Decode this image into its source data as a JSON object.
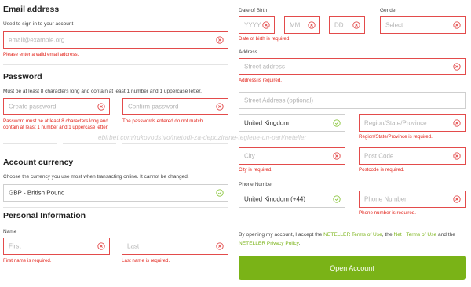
{
  "email": {
    "heading": "Email address",
    "helper": "Used to sign in to your account",
    "placeholder": "email@example.org",
    "error": "Please enter a valid email address."
  },
  "password": {
    "heading": "Password",
    "helper": "Must be at least 8 characters long and contain at least 1 number and 1 uppercase letter.",
    "create_placeholder": "Create password",
    "confirm_placeholder": "Confirm password",
    "create_error": "Password must be at least 8 characters long and contain at least 1 number and 1 uppercase letter.",
    "confirm_error": "The passwords entered do not match."
  },
  "currency": {
    "heading": "Account currency",
    "helper": "Choose the currency you use most when transacting online. It cannot be changed.",
    "value": "GBP - British Pound"
  },
  "personal": {
    "heading": "Personal Information",
    "name_label": "Name",
    "first_placeholder": "First",
    "last_placeholder": "Last",
    "first_error": "First name is required.",
    "last_error": "Last name is required."
  },
  "dob": {
    "label": "Date of Birth",
    "yyyy": "YYYY",
    "mm": "MM",
    "dd": "DD",
    "error": "Date of birth is required."
  },
  "gender": {
    "label": "Gender",
    "placeholder": "Select"
  },
  "address": {
    "label": "Address",
    "street_placeholder": "Street address",
    "street_error": "Address is required.",
    "street2_placeholder": "Street Address (optional)",
    "country_value": "United Kingdom",
    "region_placeholder": "Region/State/Province",
    "region_error": "Region/State/Province is required.",
    "city_placeholder": "City",
    "city_error": "City is required.",
    "postcode_placeholder": "Post Code",
    "postcode_error": "Postcode is required."
  },
  "phone": {
    "label": "Phone Number",
    "country_value": "United Kingdom (+44)",
    "placeholder": "Phone Number",
    "error": "Phone number is required."
  },
  "terms": {
    "prefix": "By opening my account, I accept the ",
    "neteller_terms": "NETELLER Terms of Use",
    "middle": ", the ",
    "netplus_terms": "Net+ Terms of Use",
    "and": " and the ",
    "privacy": "NETELLER Privacy Policy",
    "suffix": "."
  },
  "open_account_label": "Open Account",
  "watermark": "ebirbet.com/rukovodstvo/metodi-za-depozirane-teglene-un-pari/neteller",
  "colors": {
    "error_red": "#e2231a",
    "accent_green": "#7ab317"
  },
  "icons": {
    "error": "circle-x-icon",
    "valid": "circle-check-icon",
    "dropdown": "chevron-down-icon"
  }
}
